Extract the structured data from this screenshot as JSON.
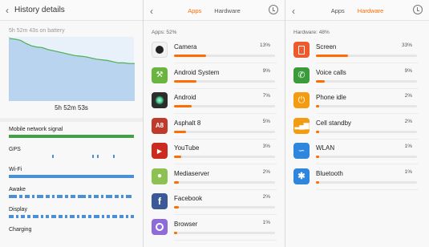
{
  "history": {
    "title": "History details",
    "on_battery": "5h 52m 43s on battery",
    "duration": "5h 52m 53s",
    "battery_curve": [
      100,
      99,
      97,
      92,
      88,
      86,
      85,
      82,
      80,
      78,
      76,
      74,
      72,
      71,
      70,
      68,
      66,
      65,
      64,
      62,
      60,
      60,
      59,
      59
    ],
    "signals": [
      {
        "label": "Mobile network signal",
        "color": "#43a047"
      },
      {
        "label": "GPS",
        "color": "#4a90d9"
      },
      {
        "label": "Wi-Fi",
        "color": "#4a90d9"
      },
      {
        "label": "Awake",
        "color": "#4a90d9"
      },
      {
        "label": "Display",
        "color": "#4a90d9"
      },
      {
        "label": "Charging",
        "color": "#4a90d9"
      }
    ]
  },
  "apps_panel": {
    "tab_apps": "Apps",
    "tab_hardware": "Hardware",
    "section": "Apps: 52%",
    "items": [
      {
        "name": "Camera",
        "pct": "13%",
        "value": 13,
        "icon": "camera-icon",
        "color": "#f2f2f2"
      },
      {
        "name": "Android System",
        "pct": "9%",
        "value": 9,
        "icon": "android-system-icon",
        "color": "#69b53f"
      },
      {
        "name": "Android",
        "pct": "7%",
        "value": 7,
        "icon": "android-icon",
        "color": "#2d2d2d"
      },
      {
        "name": "Asphalt 8",
        "pct": "5%",
        "value": 5,
        "icon": "asphalt-icon",
        "color": "#c0392b"
      },
      {
        "name": "YouTube",
        "pct": "3%",
        "value": 3,
        "icon": "youtube-icon",
        "color": "#cc2a1f"
      },
      {
        "name": "Mediaserver",
        "pct": "2%",
        "value": 2,
        "icon": "mediaserver-icon",
        "color": "#8dc152"
      },
      {
        "name": "Facebook",
        "pct": "2%",
        "value": 2,
        "icon": "facebook-icon",
        "color": "#3b5998"
      },
      {
        "name": "Browser",
        "pct": "1%",
        "value": 1,
        "icon": "browser-icon",
        "color": "#8e6bd9"
      }
    ]
  },
  "hardware_panel": {
    "tab_apps": "Apps",
    "tab_hardware": "Hardware",
    "section": "Hardware: 48%",
    "items": [
      {
        "name": "Screen",
        "pct": "33%",
        "value": 33,
        "icon": "screen-icon",
        "color": "#ef5a2c"
      },
      {
        "name": "Voice calls",
        "pct": "9%",
        "value": 9,
        "icon": "phone-icon",
        "color": "#3a9b3a"
      },
      {
        "name": "Phone idle",
        "pct": "2%",
        "value": 2,
        "icon": "power-icon",
        "color": "#f39c12"
      },
      {
        "name": "Cell standby",
        "pct": "2%",
        "value": 2,
        "icon": "signal-bars-icon",
        "color": "#f39c12"
      },
      {
        "name": "WLAN",
        "pct": "1%",
        "value": 1,
        "icon": "wifi-icon",
        "color": "#2e86de"
      },
      {
        "name": "Bluetooth",
        "pct": "1%",
        "value": 1,
        "icon": "bluetooth-icon",
        "color": "#2e86de"
      }
    ]
  }
}
